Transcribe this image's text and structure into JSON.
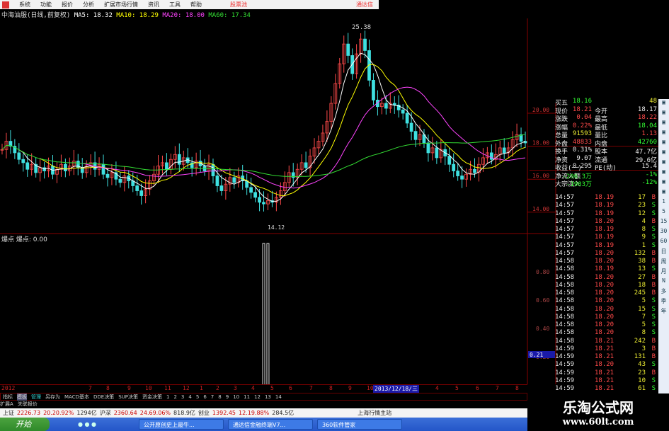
{
  "menu": {
    "items": [
      "系统",
      "功能",
      "报价",
      "分析",
      "扩展市场行情",
      "资讯",
      "工具",
      "帮助"
    ],
    "highlight": "股票池",
    "brand": "通达信"
  },
  "header": {
    "stock": "中海油服(日线,前复权)",
    "ma5": "MA5: 18.32",
    "ma10": "MA10: 18.29",
    "ma20": "MA20: 18.00",
    "ma60": "MA60: 17.34"
  },
  "colors": {
    "up": "#ff4a4a",
    "down": "#3fe0e0",
    "ma5": "#ffffff",
    "ma10": "#ffff00",
    "ma20": "#ff44ff",
    "ma60": "#33dd33",
    "grid": "#880000"
  },
  "chart_data": [
    {
      "type": "candlestick",
      "closes": [
        17.8,
        18.3,
        18.0,
        17.6,
        17.2,
        17.0,
        16.6,
        16.9,
        16.4,
        16.7,
        16.5,
        16.8,
        16.3,
        16.6,
        16.9,
        16.5,
        16.8,
        17.1,
        16.7,
        16.4,
        16.8,
        17.0,
        16.6,
        16.9,
        16.3,
        16.1,
        16.4,
        16.0,
        15.8,
        16.2,
        15.9,
        15.6,
        15.3,
        15.0,
        15.4,
        15.9,
        16.3,
        16.8,
        17.0,
        16.6,
        17.2,
        17.5,
        16.9,
        17.3,
        17.0,
        16.7,
        17.1,
        16.8,
        16.5,
        16.9,
        16.2,
        15.6,
        15.3,
        15.7,
        16.1,
        15.8,
        16.2,
        15.9,
        15.5,
        15.2,
        14.9,
        14.6,
        14.5,
        14.7,
        14.6,
        14.9,
        15.3,
        15.8,
        16.4,
        16.1,
        16.6,
        17.0,
        16.7,
        17.4,
        17.9,
        18.3,
        18.8,
        19.5,
        20.6,
        21.8,
        23.0,
        24.2,
        23.5,
        22.4,
        23.6,
        24.5,
        23.8,
        22.0,
        20.8,
        20.4,
        20.6,
        20.3,
        20.6,
        20.5,
        20.2,
        20.0,
        19.4,
        18.9,
        18.4,
        18.7,
        18.2,
        17.6,
        17.9,
        17.3,
        17.8,
        17.4,
        16.9,
        16.5,
        16.2,
        16.0,
        16.3,
        16.6,
        16.4,
        16.9,
        17.3,
        17.6,
        17.2,
        17.5,
        17.9,
        17.6,
        17.9,
        18.4,
        18.7,
        18.3,
        18.2
      ],
      "high_label": "25.38",
      "low_label": "14.12",
      "y_ticks": [
        "20.00",
        "18.00",
        "16.00",
        "14.00"
      ]
    },
    {
      "type": "bar",
      "title": "爆点 爆点: 0.00",
      "nonzero": [
        [
          62,
          1.0
        ],
        [
          63,
          1.0
        ]
      ],
      "y_ticks": [
        "0.80",
        "0.60",
        "0.40",
        "0.20"
      ],
      "current": "0.21"
    }
  ],
  "date_axis": {
    "labels": [
      "2012",
      "7",
      "8",
      "9",
      "10",
      "11",
      "12",
      "1",
      "2",
      "3",
      "4",
      "5",
      "6",
      "7",
      "8",
      "9",
      "10",
      "11",
      "12",
      "4",
      "5",
      "6",
      "7",
      "8"
    ],
    "cursor": "2013/12/18/三"
  },
  "quote": {
    "rows": [
      [
        {
          "t": "买五",
          "c": "wht"
        },
        {
          "t": "18.16",
          "c": "grn"
        },
        {
          "t": "",
          "c": "wht"
        },
        {
          "t": "48",
          "c": "yel"
        }
      ],
      [
        {
          "t": "现价",
          "c": "wht"
        },
        {
          "t": "18.21",
          "c": "red"
        },
        {
          "t": "今开",
          "c": "wht"
        },
        {
          "t": "18.17",
          "c": "wht"
        }
      ],
      [
        {
          "t": "涨跌",
          "c": "wht"
        },
        {
          "t": "0.04",
          "c": "red"
        },
        {
          "t": "最高",
          "c": "wht"
        },
        {
          "t": "18.22",
          "c": "red"
        }
      ],
      [
        {
          "t": "涨幅",
          "c": "wht"
        },
        {
          "t": "0.22%",
          "c": "red"
        },
        {
          "t": "最低",
          "c": "wht"
        },
        {
          "t": "18.04",
          "c": "grn"
        }
      ],
      [
        {
          "t": "总量",
          "c": "wht"
        },
        {
          "t": "91593",
          "c": "yel"
        },
        {
          "t": "量比",
          "c": "wht"
        },
        {
          "t": "1.13",
          "c": "red"
        }
      ],
      [
        {
          "t": "外盘",
          "c": "wht"
        },
        {
          "t": "48833",
          "c": "red"
        },
        {
          "t": "内盘",
          "c": "wht"
        },
        {
          "t": "42760",
          "c": "grn"
        }
      ],
      [
        {
          "t": "换手",
          "c": "wht"
        },
        {
          "t": "0.31%",
          "c": "wht"
        },
        {
          "t": "股本",
          "c": "wht"
        },
        {
          "t": "47.7亿",
          "c": "wht"
        }
      ],
      [
        {
          "t": "净资",
          "c": "wht"
        },
        {
          "t": "9.07",
          "c": "wht"
        },
        {
          "t": "流通",
          "c": "wht"
        },
        {
          "t": "29.6亿",
          "c": "wht"
        }
      ],
      [
        {
          "t": "收益(一)",
          "c": "wht"
        },
        {
          "t": "0.295",
          "c": "wht"
        },
        {
          "t": "PE(动)",
          "c": "wht"
        },
        {
          "t": "15.4",
          "c": "wht"
        }
      ],
      [
        {
          "t": "净流入额",
          "c": "wht"
        },
        {
          "t": "-206.3万",
          "c": "grn"
        },
        {
          "t": "",
          "c": "wht"
        },
        {
          "t": "-1%",
          "c": "grn"
        }
      ],
      [
        {
          "t": "大宗流入",
          "c": "wht"
        },
        {
          "t": "-1983万",
          "c": "grn"
        },
        {
          "t": "",
          "c": "wht"
        },
        {
          "t": "-12%",
          "c": "grn"
        }
      ]
    ]
  },
  "trades": [
    [
      "14:57",
      "18.19",
      "17",
      "B"
    ],
    [
      "14:57",
      "18.19",
      "23",
      "S"
    ],
    [
      "14:57",
      "18.19",
      "12",
      "S"
    ],
    [
      "14:57",
      "18.20",
      "4",
      "B"
    ],
    [
      "14:57",
      "18.19",
      "8",
      "S"
    ],
    [
      "14:57",
      "18.19",
      "9",
      "S"
    ],
    [
      "14:57",
      "18.19",
      "1",
      "S"
    ],
    [
      "14:57",
      "18.20",
      "132",
      "B"
    ],
    [
      "14:58",
      "18.20",
      "38",
      "B"
    ],
    [
      "14:58",
      "18.19",
      "13",
      "S"
    ],
    [
      "14:58",
      "18.20",
      "27",
      "B"
    ],
    [
      "14:58",
      "18.20",
      "18",
      "B"
    ],
    [
      "14:58",
      "18.20",
      "245",
      "B"
    ],
    [
      "14:58",
      "18.20",
      "5",
      "S"
    ],
    [
      "14:58",
      "18.20",
      "15",
      "S"
    ],
    [
      "14:58",
      "18.20",
      "7",
      "S"
    ],
    [
      "14:58",
      "18.20",
      "5",
      "S"
    ],
    [
      "14:58",
      "18.20",
      "8",
      "S"
    ],
    [
      "14:58",
      "18.21",
      "242",
      "B"
    ],
    [
      "14:59",
      "18.21",
      "3",
      "B"
    ],
    [
      "14:59",
      "18.21",
      "131",
      "B"
    ],
    [
      "14:59",
      "18.20",
      "43",
      "S"
    ],
    [
      "14:59",
      "18.21",
      "23",
      "B"
    ],
    [
      "14:59",
      "18.21",
      "10",
      "S"
    ],
    [
      "14:59",
      "18.21",
      "61",
      "S"
    ]
  ],
  "toolbar": {
    "periods": [
      "1",
      "5",
      "15",
      "30",
      "60",
      "日",
      "周",
      "月",
      "N",
      "多",
      "季",
      "年"
    ]
  },
  "tabs": [
    "指标",
    "模板",
    "管理",
    "另存为",
    "MACD基本",
    "DDE决策",
    "SUP决策",
    "资金决策",
    "1",
    "2",
    "3",
    "4",
    "5",
    "6",
    "7",
    "8",
    "9",
    "10",
    "11",
    "12",
    "13",
    "14"
  ],
  "ext_tabs": [
    "扩展A",
    "关联报价"
  ],
  "status": {
    "items": [
      {
        "t": "上证",
        "c": "#222"
      },
      {
        "t": "2226.73",
        "c": "#c00"
      },
      {
        "t": "20.20.92%",
        "c": "#c00"
      },
      {
        "t": "1294亿",
        "c": "#222"
      },
      {
        "t": "沪深",
        "c": "#222"
      },
      {
        "t": "2360.64",
        "c": "#c00"
      },
      {
        "t": "24.69.06%",
        "c": "#c00"
      },
      {
        "t": "818.9亿",
        "c": "#222"
      },
      {
        "t": "创业",
        "c": "#222"
      },
      {
        "t": "1392.45",
        "c": "#c00"
      },
      {
        "t": "12.19.88%",
        "c": "#c00"
      },
      {
        "t": "284.5亿",
        "c": "#222"
      }
    ],
    "server": "上海行情主站"
  },
  "taskbar": {
    "start": "开始",
    "tasks": [
      "公开原创史上最牛...",
      "通达信金融终端V7...",
      "360软件管家"
    ]
  },
  "watermark": {
    "title": "乐淘公式网",
    "url": "www.60lt.com"
  }
}
